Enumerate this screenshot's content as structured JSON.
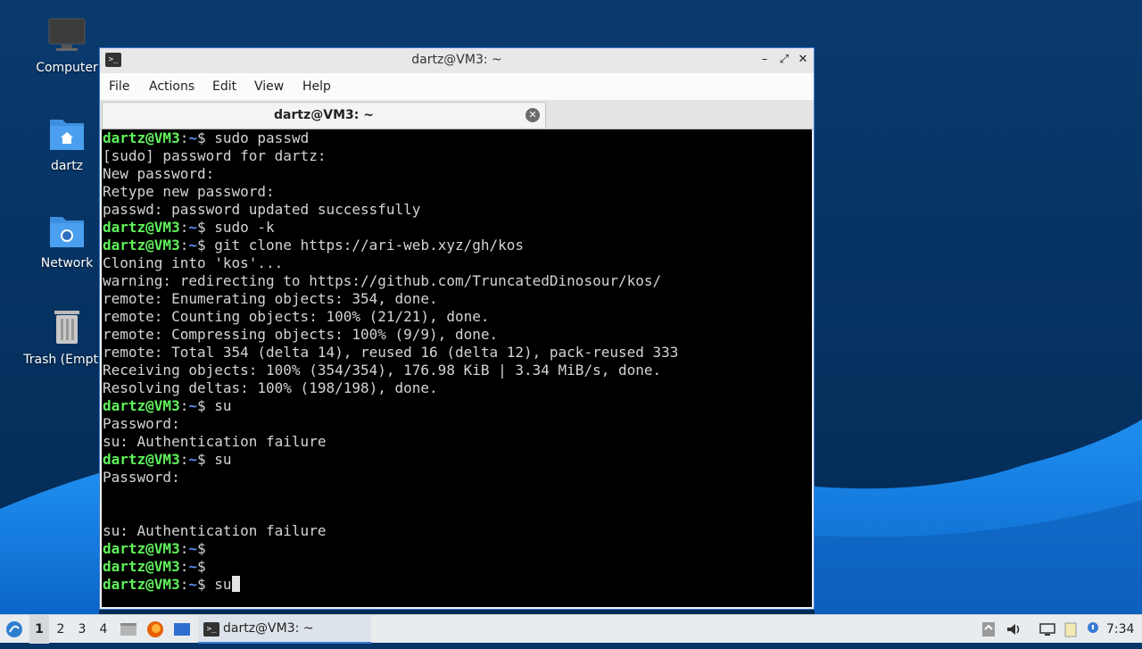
{
  "desktop": {
    "icons": [
      {
        "label": "Computer",
        "icon": "monitor-icon"
      },
      {
        "label": "dartz",
        "icon": "home-folder-icon"
      },
      {
        "label": "Network",
        "icon": "network-folder-icon"
      },
      {
        "label": "Trash (Empty)",
        "icon": "trash-icon"
      }
    ]
  },
  "window": {
    "title": "dartz@VM3: ~",
    "menu": [
      "File",
      "Actions",
      "Edit",
      "View",
      "Help"
    ],
    "tab_label": "dartz@VM3: ~"
  },
  "terminal": {
    "prompt_user": "dartz@VM3",
    "prompt_path": "~",
    "lines": [
      {
        "type": "cmd",
        "text": "sudo passwd"
      },
      {
        "type": "out",
        "text": "[sudo] password for dartz:"
      },
      {
        "type": "out",
        "text": "New password:"
      },
      {
        "type": "out",
        "text": "Retype new password:"
      },
      {
        "type": "out",
        "text": "passwd: password updated successfully"
      },
      {
        "type": "cmd",
        "text": "sudo -k"
      },
      {
        "type": "cmd",
        "text": "git clone https://ari-web.xyz/gh/kos"
      },
      {
        "type": "out",
        "text": "Cloning into 'kos'..."
      },
      {
        "type": "out",
        "text": "warning: redirecting to https://github.com/TruncatedDinosour/kos/"
      },
      {
        "type": "out",
        "text": "remote: Enumerating objects: 354, done."
      },
      {
        "type": "out",
        "text": "remote: Counting objects: 100% (21/21), done."
      },
      {
        "type": "out",
        "text": "remote: Compressing objects: 100% (9/9), done."
      },
      {
        "type": "out",
        "text": "remote: Total 354 (delta 14), reused 16 (delta 12), pack-reused 333"
      },
      {
        "type": "out",
        "text": "Receiving objects: 100% (354/354), 176.98 KiB | 3.34 MiB/s, done."
      },
      {
        "type": "out",
        "text": "Resolving deltas: 100% (198/198), done."
      },
      {
        "type": "cmd",
        "text": "su"
      },
      {
        "type": "out",
        "text": "Password:"
      },
      {
        "type": "out",
        "text": "su: Authentication failure"
      },
      {
        "type": "cmd",
        "text": "su"
      },
      {
        "type": "out",
        "text": "Password:"
      },
      {
        "type": "out",
        "text": ""
      },
      {
        "type": "out",
        "text": ""
      },
      {
        "type": "out",
        "text": "su: Authentication failure"
      },
      {
        "type": "cmd",
        "text": ""
      },
      {
        "type": "cmd",
        "text": ""
      },
      {
        "type": "cmd",
        "text": "su",
        "cursor": true
      }
    ]
  },
  "taskbar": {
    "workspaces": [
      "1",
      "2",
      "3",
      "4"
    ],
    "active_workspace": "1",
    "task_label": "dartz@VM3: ~",
    "clock": "7:34"
  },
  "colors": {
    "prompt_user": "#5ff25a",
    "prompt_path": "#5c8ef0",
    "terminal_bg": "#000000",
    "desktop_bg": "#053567",
    "accent": "#3a7bd5"
  }
}
